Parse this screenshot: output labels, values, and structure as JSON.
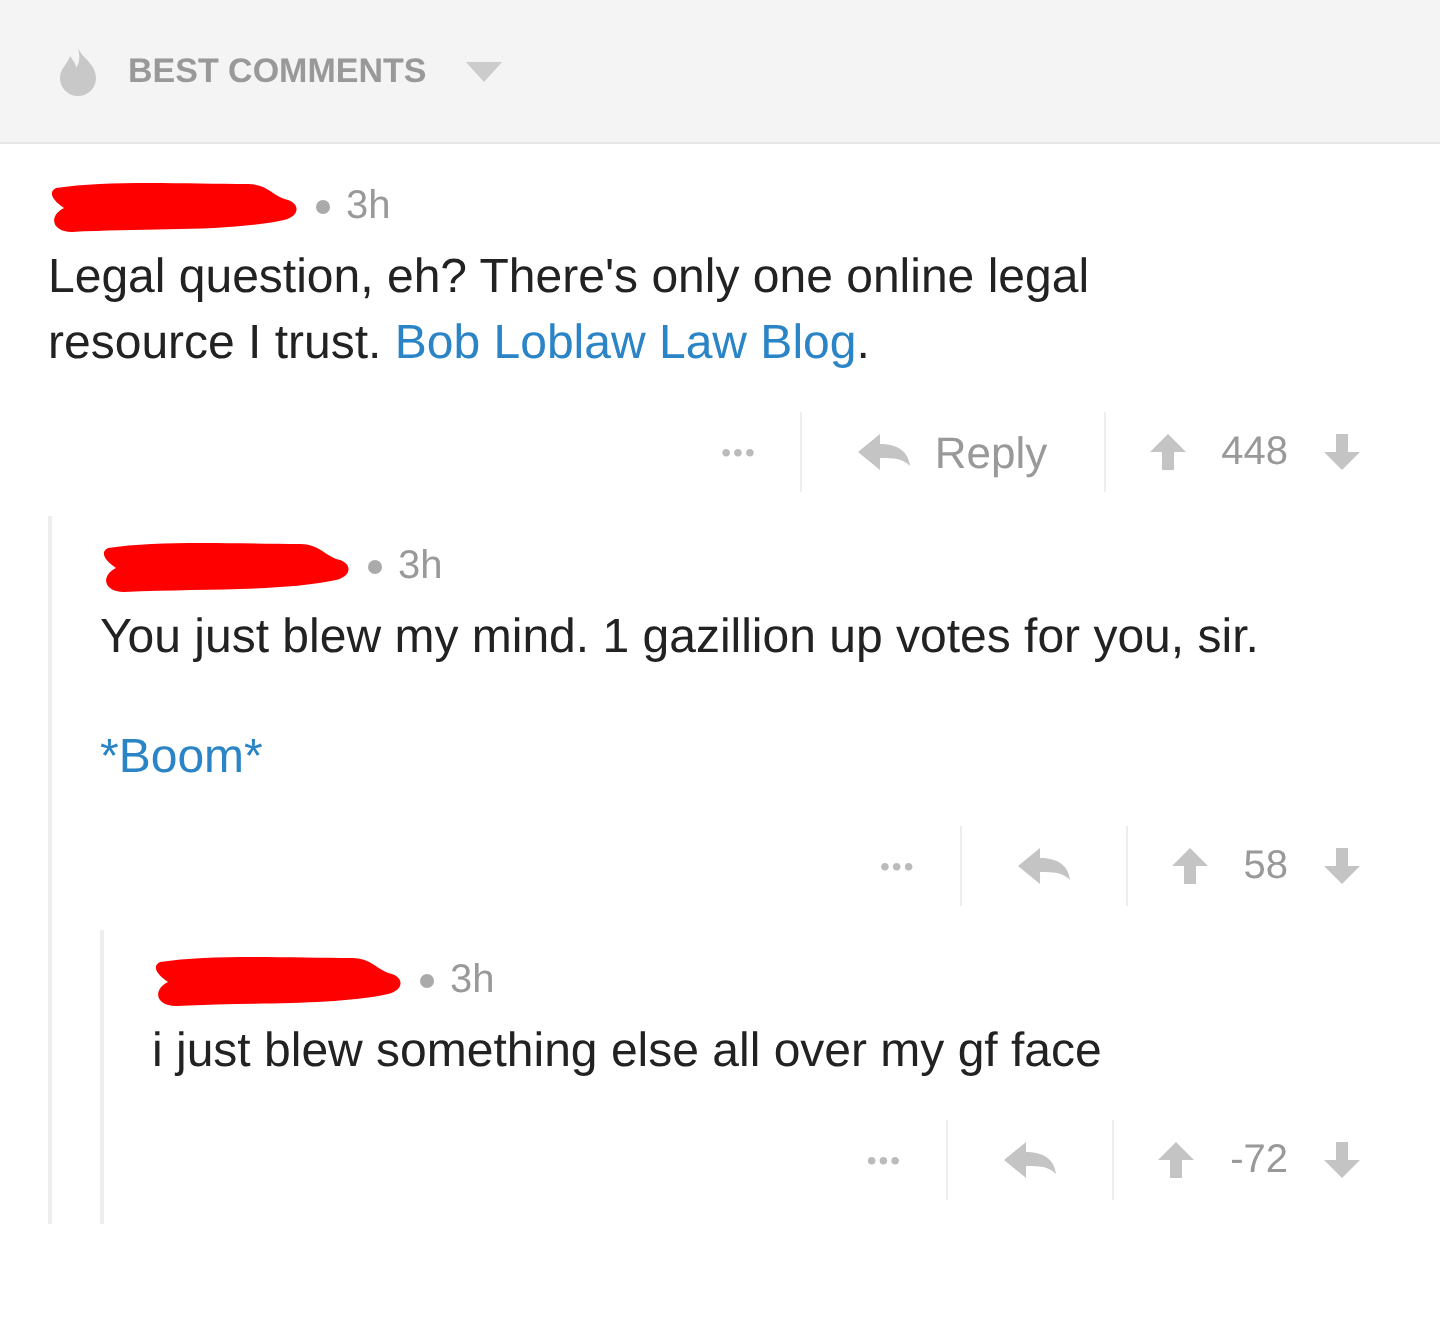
{
  "sort_bar": {
    "label": "BEST COMMENTS"
  },
  "comments": [
    {
      "age": "3h",
      "paragraphs": [
        [
          {
            "kind": "text",
            "text": "Legal question, eh? There's only one online legal resource I trust. "
          },
          {
            "kind": "link",
            "text": "Bob Loblaw Law Blog"
          },
          {
            "kind": "text",
            "text": "."
          }
        ]
      ],
      "more": "•••",
      "reply_label": "Reply",
      "score": "448",
      "children": [
        {
          "age": "3h",
          "paragraphs": [
            [
              {
                "kind": "text",
                "text": "You just blew my mind.  1 gazillion up votes for you, sir."
              }
            ],
            [
              {
                "kind": "link",
                "text": "*Boom*"
              }
            ]
          ],
          "more": "•••",
          "score": "58",
          "children": [
            {
              "age": "3h",
              "paragraphs": [
                [
                  {
                    "kind": "text",
                    "text": "i just blew something else all over my gf face"
                  }
                ]
              ],
              "more": "•••",
              "score": "-72"
            }
          ]
        }
      ]
    }
  ]
}
